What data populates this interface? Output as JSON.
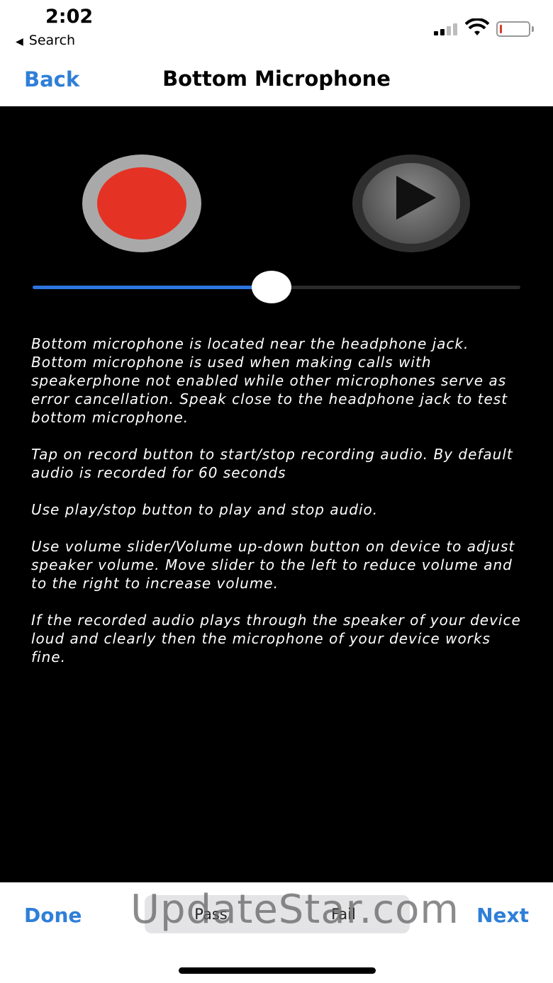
{
  "status_bar": {
    "time": "2:02",
    "back_app": "Search",
    "signal_icon": "cellular-signal-icon",
    "wifi_icon": "wifi-icon",
    "battery_icon": "battery-low-icon",
    "battery_color": "#e0392b"
  },
  "nav": {
    "back_label": "Back",
    "title": "Bottom Microphone",
    "accent": "#2f7fd8"
  },
  "controls": {
    "record_icon": "record-icon",
    "play_icon": "play-icon",
    "record_color": "#e43325",
    "volume_fraction": 0.49,
    "slider_fill_color": "#2d74df"
  },
  "instructions": [
    "Bottom microphone is located near the headphone jack. Bottom microphone is used when making calls with speakerphone not enabled while other microphones serve as error cancellation. Speak close to the headphone jack to test bottom microphone.",
    "Tap on record button to start/stop recording audio. By default audio is recorded for 60 seconds",
    "Use play/stop button to play and stop audio.",
    "Use volume slider/Volume up-down button on device to adjust speaker volume. Move slider to the left to reduce volume and to the right to increase volume.",
    "If the recorded audio plays through the speaker of your device loud and clearly then the microphone of your device works fine."
  ],
  "toolbar": {
    "done_label": "Done",
    "next_label": "Next",
    "segments": [
      "Pass",
      "Fail"
    ],
    "watermark": "UpdateStar.com"
  }
}
